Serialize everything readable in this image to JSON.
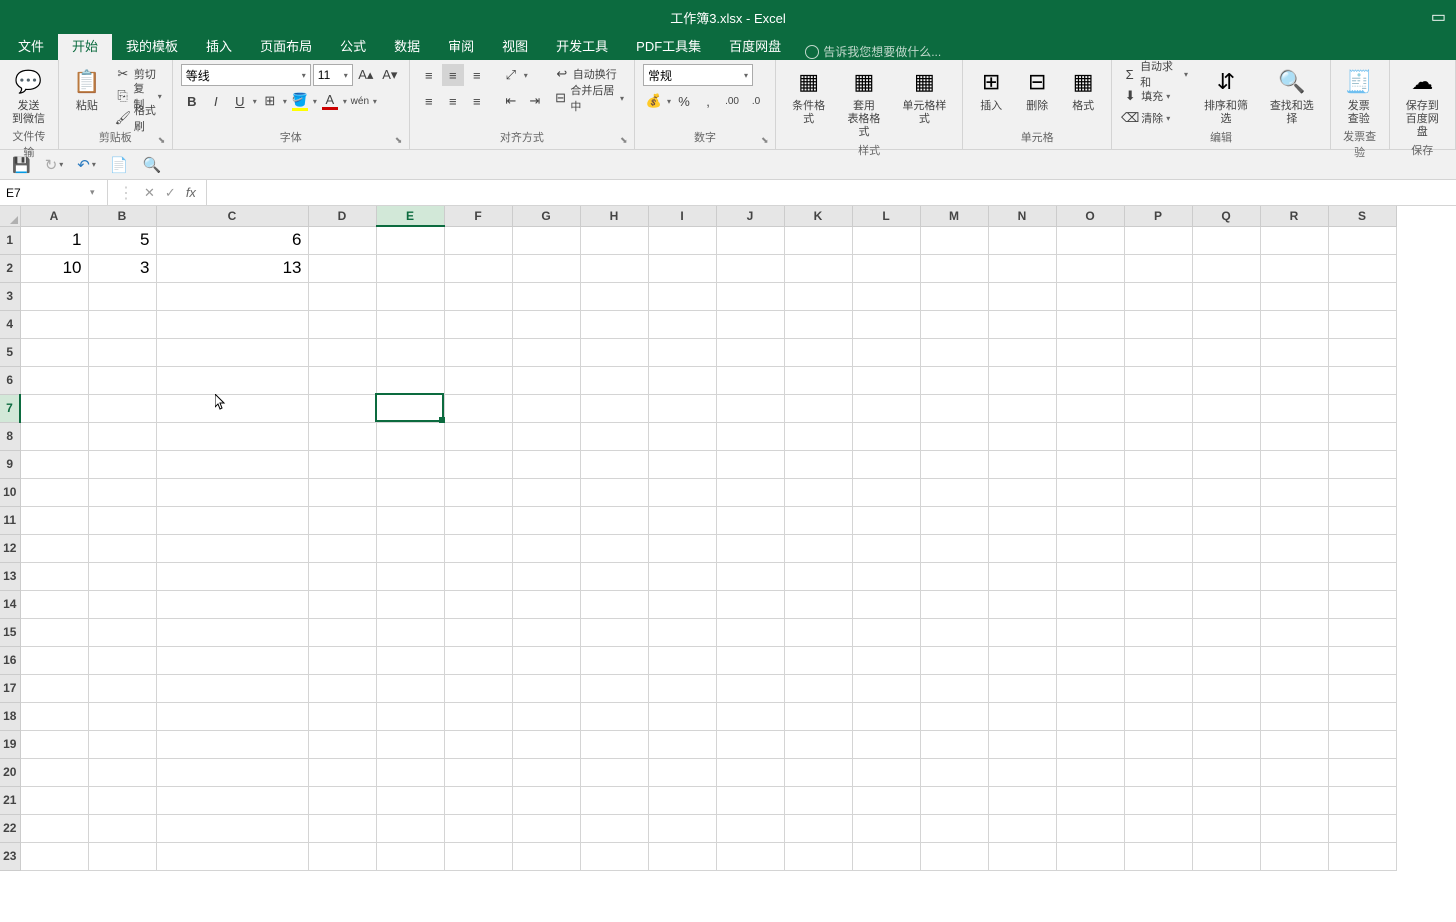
{
  "title": "工作簿3.xlsx - Excel",
  "tabs": {
    "file": "文件",
    "home": "开始",
    "mytemplate": "我的模板",
    "insert": "插入",
    "pagelayout": "页面布局",
    "formulas": "公式",
    "data": "数据",
    "review": "审阅",
    "view": "视图",
    "developer": "开发工具",
    "pdftools": "PDF工具集",
    "baidudisk": "百度网盘"
  },
  "tellme": "告诉我您想要做什么...",
  "ribbon": {
    "wechat": {
      "label": "发送\n到微信",
      "group": "文件传输"
    },
    "clipboard": {
      "paste": "粘贴",
      "cut": "剪切",
      "copy": "复制",
      "brush": "格式刷",
      "group": "剪贴板"
    },
    "font": {
      "name": "等线",
      "size": "11",
      "group": "字体"
    },
    "alignment": {
      "wrap": "自动换行",
      "merge": "合并后居中",
      "group": "对齐方式"
    },
    "number": {
      "format": "常规",
      "group": "数字"
    },
    "styles": {
      "condformat": "条件格式",
      "tableformat": "套用\n表格格式",
      "cellstyle": "单元格样式",
      "group": "样式"
    },
    "cells": {
      "insert": "插入",
      "delete": "删除",
      "format": "格式",
      "group": "单元格"
    },
    "editing": {
      "autosum": "自动求和",
      "fill": "填充",
      "clear": "清除",
      "sortfilter": "排序和筛选",
      "findselect": "查找和选择",
      "group": "编辑"
    },
    "invoice": {
      "label": "发票\n查验",
      "group": "发票查验"
    },
    "save": {
      "label": "保存到\n百度网盘",
      "group": "保存"
    }
  },
  "namebox": "E7",
  "columns": [
    "A",
    "B",
    "C",
    "D",
    "E",
    "F",
    "G",
    "H",
    "I",
    "J",
    "K",
    "L",
    "M",
    "N",
    "O",
    "P",
    "Q",
    "R",
    "S"
  ],
  "rows": [
    "1",
    "2",
    "3",
    "4",
    "5",
    "6",
    "7",
    "8",
    "9",
    "10",
    "11",
    "12",
    "13",
    "14",
    "15",
    "16",
    "17",
    "18",
    "19",
    "20",
    "21",
    "22",
    "23"
  ],
  "cells": {
    "A1": "1",
    "B1": "5",
    "C1": "6",
    "A2": "10",
    "B2": "3",
    "C2": "13"
  },
  "selected": {
    "col": "E",
    "row": "7"
  }
}
